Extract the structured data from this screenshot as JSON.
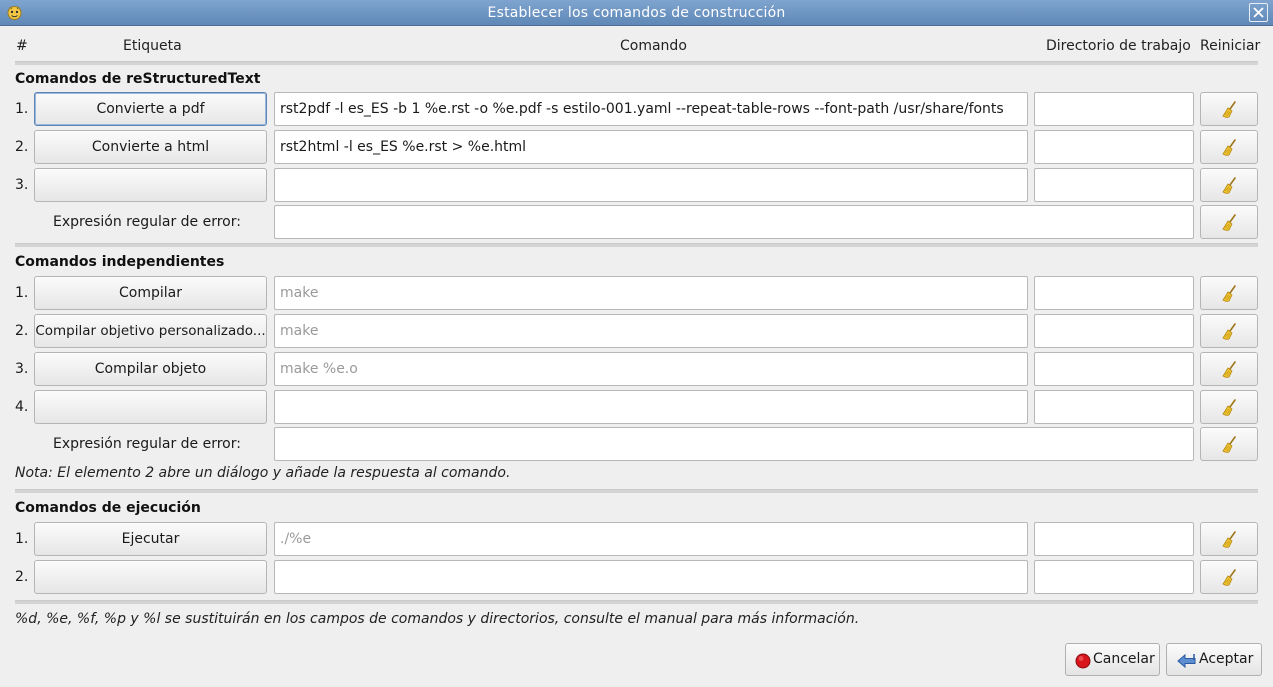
{
  "window": {
    "title": "Establecer los comandos de construcción"
  },
  "headers": {
    "num": "#",
    "label": "Etiqueta",
    "command": "Comando",
    "workdir": "Directorio de trabajo",
    "reset": "Reiniciar"
  },
  "sections": {
    "rst": {
      "title": "Comandos de reStructuredText",
      "rows": [
        {
          "num": "1.",
          "label": "Convierte a pdf",
          "command": "rst2pdf  -l es_ES -b 1 %e.rst -o %e.pdf -s estilo-001.yaml --repeat-table-rows --font-path /usr/share/fonts",
          "workdir": ""
        },
        {
          "num": "2.",
          "label": "Convierte a html",
          "command": "rst2html -l es_ES  %e.rst > %e.html",
          "workdir": ""
        },
        {
          "num": "3.",
          "label": "",
          "command": "",
          "workdir": ""
        }
      ],
      "error_label": "Expresión regular de error:",
      "error_value": ""
    },
    "independent": {
      "title": "Comandos independientes",
      "rows": [
        {
          "num": "1.",
          "label": "Compilar",
          "command": "make",
          "workdir": ""
        },
        {
          "num": "2.",
          "label": "Compilar objetivo personalizado...",
          "command": "make",
          "workdir": ""
        },
        {
          "num": "3.",
          "label": "Compilar objeto",
          "command": "make %e.o",
          "workdir": ""
        },
        {
          "num": "4.",
          "label": "",
          "command": "",
          "workdir": ""
        }
      ],
      "error_label": "Expresión regular de error:",
      "error_value": "",
      "note": "Nota: El elemento 2 abre un diálogo y añade la respuesta al comando."
    },
    "execute": {
      "title": "Comandos de ejecución",
      "rows": [
        {
          "num": "1.",
          "label": "Ejecutar",
          "command": "./%e",
          "workdir": ""
        },
        {
          "num": "2.",
          "label": "",
          "command": "",
          "workdir": ""
        }
      ]
    }
  },
  "footer_note": "%d, %e, %f, %p y %l se sustituirán en los campos de comandos y directorios, consulte el manual para más información.",
  "buttons": {
    "cancel": "Cancelar",
    "accept": "Aceptar"
  },
  "icons": {
    "app": "geany-icon",
    "close": "close-icon",
    "reset": "broom-icon",
    "cancel": "cancel-icon",
    "accept": "ok-arrow-icon"
  }
}
